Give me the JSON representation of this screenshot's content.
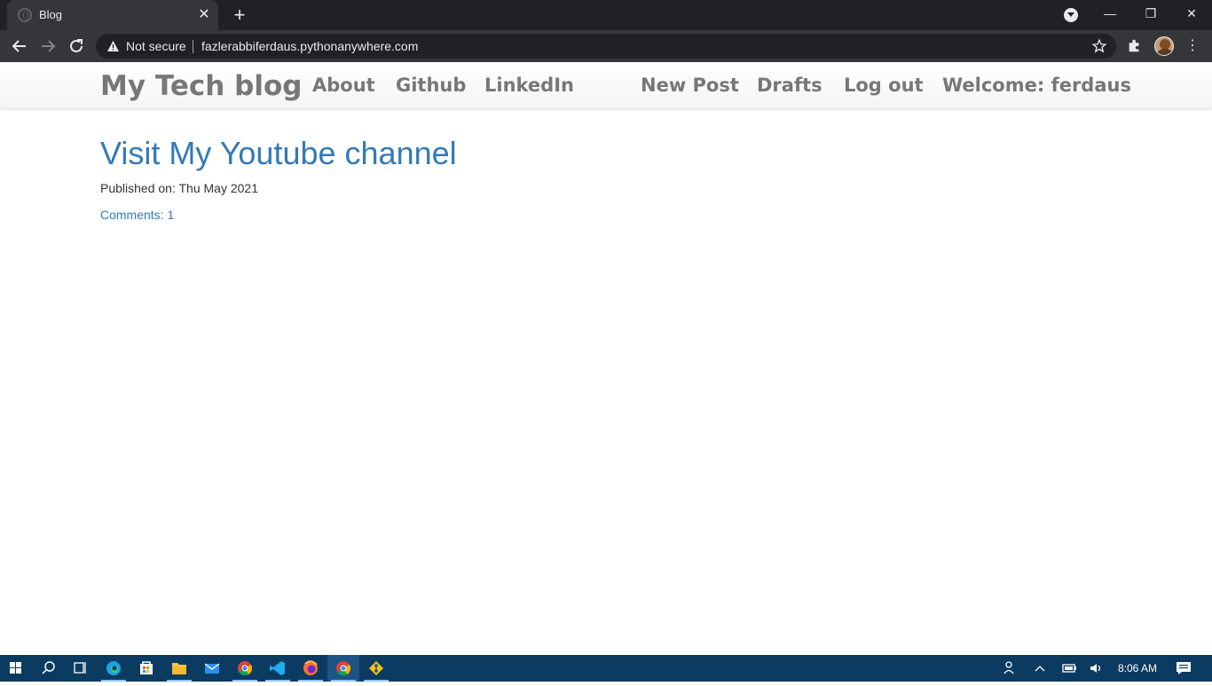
{
  "browser": {
    "tab_title": "Blog",
    "tab_close": "✕",
    "new_tab": "+",
    "security_label": "Not secure",
    "url": "fazlerabbiferdaus.pythonanywhere.com",
    "win_minimize": "—",
    "win_restore": "❐",
    "win_close": "✕",
    "menu": "⋮"
  },
  "site": {
    "brand": "My Tech blog",
    "nav_left": [
      "About",
      "Github",
      "LinkedIn"
    ],
    "nav_right": [
      "New Post",
      "Drafts",
      "Log out",
      "Welcome: ferdaus"
    ]
  },
  "post": {
    "title": "Visit My Youtube channel",
    "published": "Published on: Thu May 2021",
    "comments": "Comments: 1"
  },
  "taskbar": {
    "apps": [
      "start",
      "search",
      "task-view",
      "edge",
      "store",
      "file-explorer",
      "mail",
      "chrome",
      "vscode",
      "firefox",
      "chrome-active",
      "git"
    ],
    "clock": "8:06 AM"
  }
}
